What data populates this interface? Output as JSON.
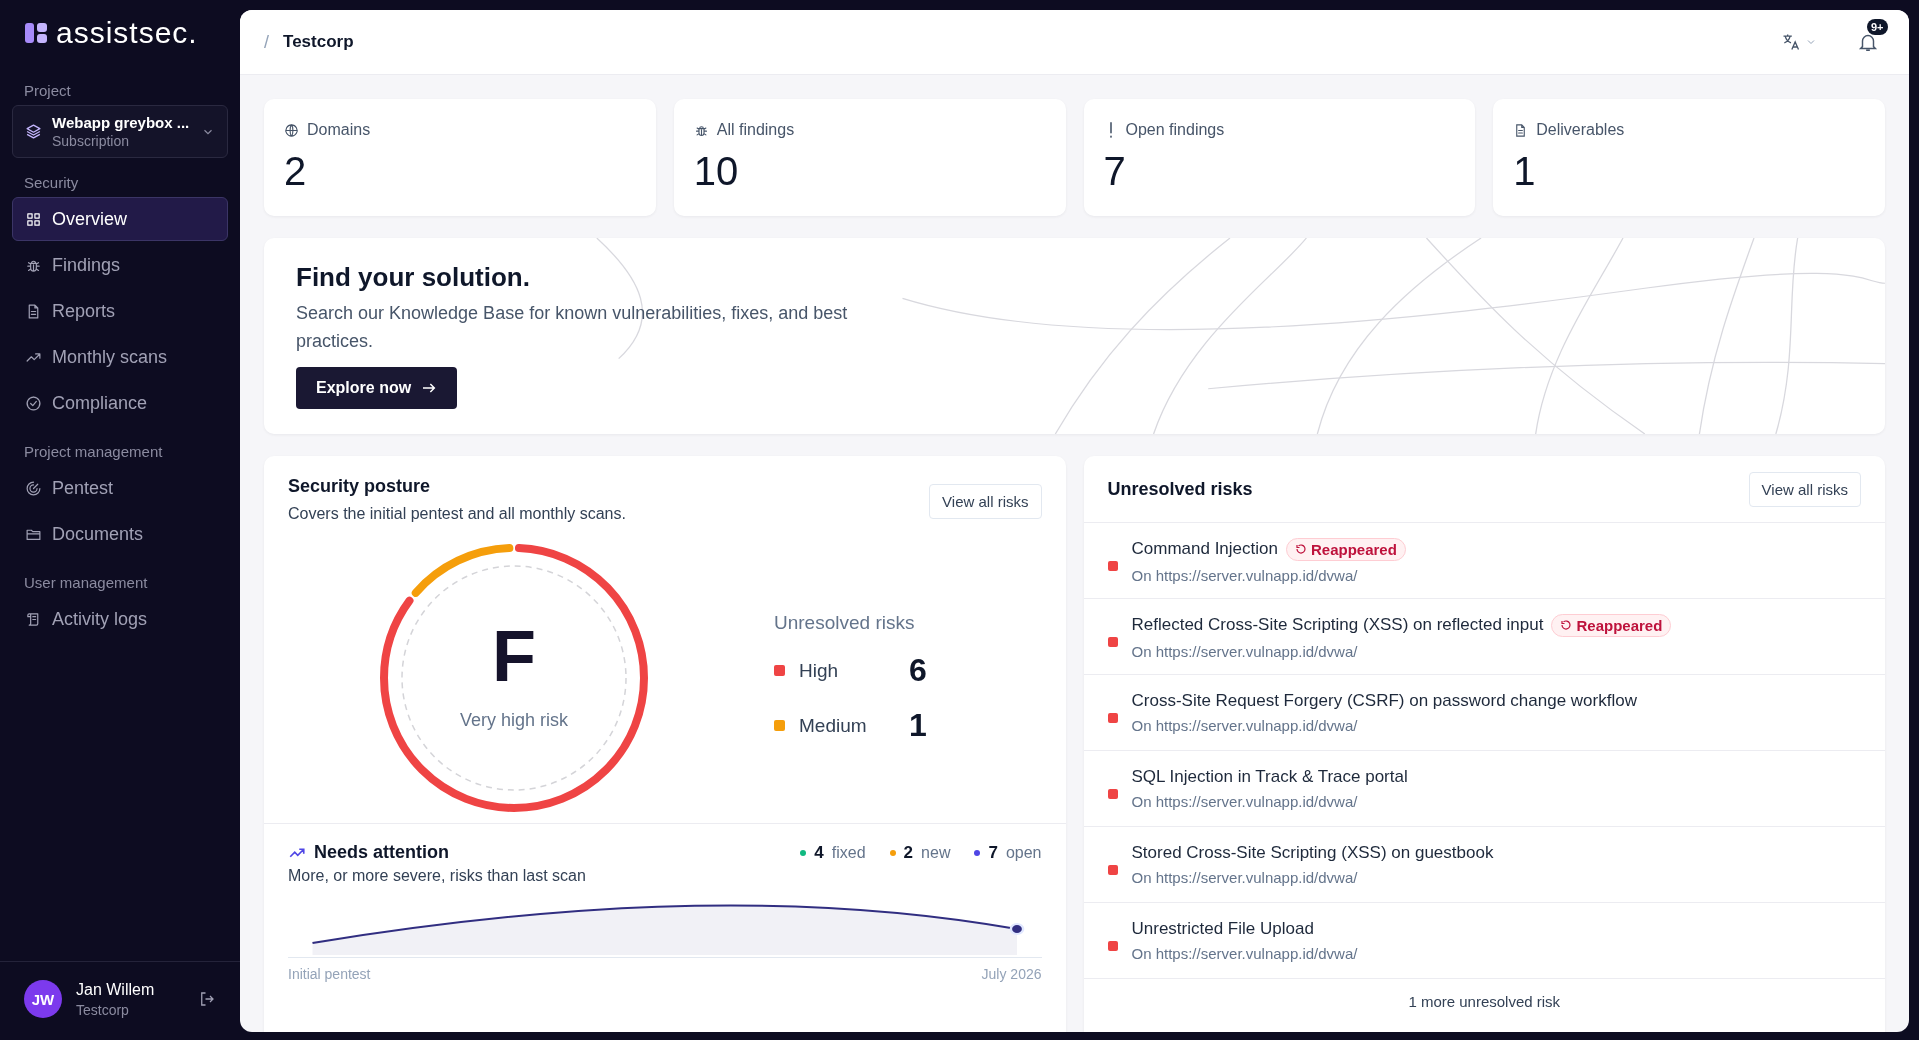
{
  "brand": "assistsec.",
  "project": {
    "label": "Project",
    "name": "Webapp greybox ...",
    "plan": "Subscription"
  },
  "nav": [
    {
      "heading": "Security",
      "items": [
        {
          "label": "Overview",
          "selected": true
        },
        {
          "label": "Findings",
          "selected": false
        },
        {
          "label": "Reports",
          "selected": false
        },
        {
          "label": "Monthly scans",
          "selected": false
        },
        {
          "label": "Compliance",
          "selected": false
        }
      ]
    },
    {
      "heading": "Project management",
      "items": [
        {
          "label": "Pentest",
          "selected": false
        },
        {
          "label": "Documents",
          "selected": false
        }
      ]
    },
    {
      "heading": "User management",
      "items": [
        {
          "label": "Activity logs",
          "selected": false
        }
      ]
    }
  ],
  "user": {
    "initials": "JW",
    "name": "Jan Willem",
    "org": "Testcorp"
  },
  "header": {
    "separator": "/",
    "breadcrumb": "Testcorp",
    "notifications": "9+"
  },
  "stats": [
    {
      "label": "Domains",
      "value": "2"
    },
    {
      "label": "All findings",
      "value": "10"
    },
    {
      "label": "Open findings",
      "value": "7"
    },
    {
      "label": "Deliverables",
      "value": "1"
    }
  ],
  "banner": {
    "title": "Find your solution.",
    "text": "Search our Knowledge Base for known vulnerabilities, fixes, and best practices.",
    "button": "Explore now"
  },
  "posture": {
    "title": "Security posture",
    "subtitle": "Covers the initial pentest and all monthly scans.",
    "button": "View all risks",
    "grade": "F",
    "grade_label": "Very high risk",
    "legend_title": "Unresolved risks",
    "legend": [
      {
        "label": "High",
        "count": "6",
        "color": "#ef4444"
      },
      {
        "label": "Medium",
        "count": "1",
        "color": "#f59e0b"
      }
    ]
  },
  "attention": {
    "title": "Needs attention",
    "subtitle": "More, or more severe, risks than last scan",
    "counts": [
      {
        "count": "4",
        "label": "fixed",
        "color": "#10b981"
      },
      {
        "count": "2",
        "label": "new",
        "color": "#f59e0b"
      },
      {
        "count": "7",
        "label": "open",
        "color": "#4f46e5"
      }
    ],
    "x_start": "Initial pentest",
    "x_end": "July 2026"
  },
  "risks": {
    "title": "Unresolved risks",
    "button": "View all risks",
    "footer": "1 more unresolved risk",
    "items": [
      {
        "title": "Command Injection",
        "location": "On https://server.vulnapp.id/dvwa/",
        "color": "#ef4444",
        "badge": "Reappeared"
      },
      {
        "title": "Reflected Cross-Site Scripting (XSS) on reflected input",
        "location": "On https://server.vulnapp.id/dvwa/",
        "color": "#ef4444",
        "badge": "Reappeared"
      },
      {
        "title": "Cross-Site Request Forgery (CSRF) on password change workflow",
        "location": "On https://server.vulnapp.id/dvwa/",
        "color": "#ef4444"
      },
      {
        "title": "SQL Injection in Track & Trace portal",
        "location": "On https://server.vulnapp.id/dvwa/",
        "color": "#ef4444"
      },
      {
        "title": "Stored Cross-Site Scripting (XSS) on guestbook",
        "location": "On https://server.vulnapp.id/dvwa/",
        "color": "#ef4444"
      },
      {
        "title": "Unrestricted File Upload",
        "location": "On https://server.vulnapp.id/dvwa/",
        "color": "#ef4444"
      }
    ]
  }
}
